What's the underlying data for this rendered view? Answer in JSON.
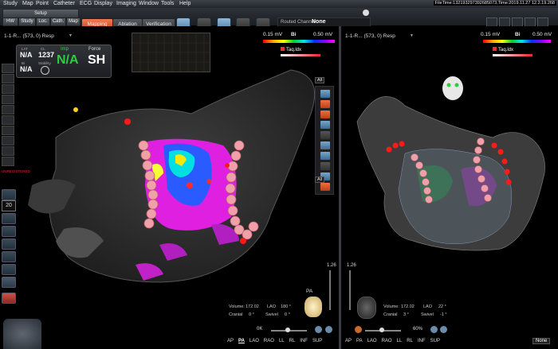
{
  "menu": [
    "Study",
    "Map",
    "Point",
    "Catheter",
    "ECG",
    "Display",
    "Imaging",
    "Window",
    "Tools",
    "Help"
  ],
  "fileinfo": "FileTime:132193297392685073,Time:2019.11.27 12.2.19.268",
  "toolbar": {
    "setup": "Setup",
    "small_tabs": [
      "HW",
      "Study",
      "Loc.",
      "Cath.",
      "Map"
    ],
    "main_tabs": [
      "Mapping",
      "Ablation",
      "Verification"
    ],
    "routed_label": "Routed Channel",
    "routed_value": "None"
  },
  "left": {
    "header": "1-1-R... (573, 0) Resp",
    "scale_min": "0.15 mV",
    "scale_bi": "Bi",
    "scale_max": "0.50 mV",
    "lat_label": "LAT",
    "lat_value": "N/A",
    "cl_label": "CL",
    "cl_value": "1237",
    "imp_label": "Imp",
    "imp_value": "N/A",
    "force_label": "Force",
    "force_value": "SH",
    "bi_label": "Bi",
    "bi_value": "N/A",
    "stability_label": "Stability",
    "unregistered": "UNREGISTERED",
    "dd_all_top": "All",
    "dd_all_bottom": "All",
    "counter": "20",
    "volume_label": "Volume:",
    "volume_value": "172.02",
    "lao_label": "LAO",
    "lao_value": "180 °",
    "cranial_label": "Cranial",
    "cranial_value": "0 °",
    "swivel_label": "Swivel",
    "swivel_value": "0 °",
    "zoom": "0K",
    "orient_marker": "PA",
    "scale_num": "1.26",
    "views": [
      "AP",
      "PA",
      "LAO",
      "RAO",
      "LL",
      "RL",
      "INF",
      "SUP"
    ]
  },
  "right": {
    "header": "1-1-R... (573, 0) Resp",
    "scale_min": "0.15 mV",
    "scale_bi": "Bi",
    "scale_max": "0.50 mV",
    "volume_label": "Volume:",
    "volume_value": "172.02",
    "lao_label": "LAO",
    "lao_value": "22 °",
    "cranial_label": "Cranial",
    "cranial_value": "3 °",
    "swivel_label": "Swivel",
    "swivel_value": "-1 °",
    "zoom": "60%",
    "scale_num": "1.26",
    "views": [
      "AP",
      "PA",
      "LAO",
      "RAO",
      "LL",
      "RL",
      "INF",
      "SUP"
    ],
    "none_btn": "None"
  },
  "taq_label": "Taq.ldx",
  "colors": {
    "accent": "#e8643c",
    "toolbar": "#2a2d33",
    "grid_green": "#2ecc40"
  }
}
